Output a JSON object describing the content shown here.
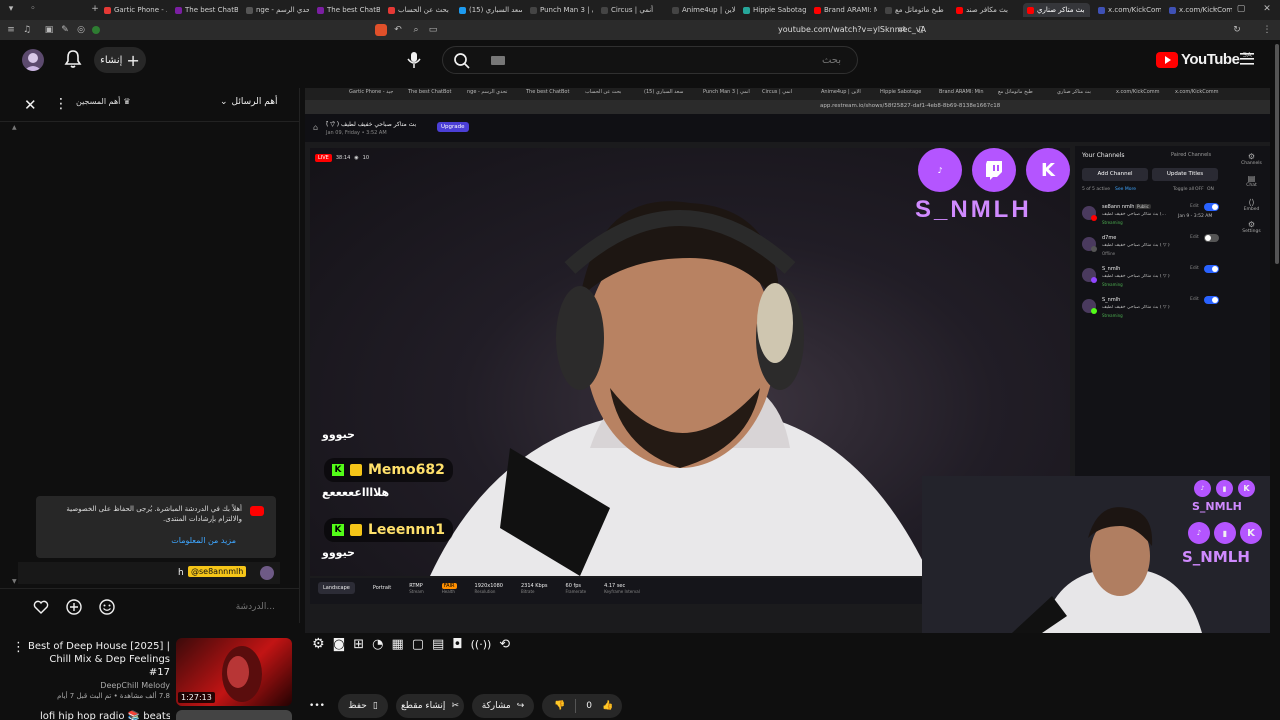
{
  "browser": {
    "tabs": [
      {
        "label": "Gartic Phone - جيد",
        "color": "#e53935"
      },
      {
        "label": "The best ChatBot",
        "color": "#7b1fa2"
      },
      {
        "label": "nge - تحدي الرسم",
        "color": "#555"
      },
      {
        "label": "The best ChatBot",
        "color": "#7b1fa2"
      },
      {
        "label": "بحث عن الحساب",
        "color": "#e53935"
      },
      {
        "label": "(15) سعد السباري",
        "color": "#1d9bf0"
      },
      {
        "label": "Punch Man 3 | أنمي",
        "color": "#444"
      },
      {
        "label": "Circus | أنمي",
        "color": "#444"
      },
      {
        "label": "Anime4up | الاين",
        "color": "#444"
      },
      {
        "label": "Hippie Sabotage",
        "color": "#26a69a"
      },
      {
        "label": "Brand ARAMI: Min",
        "color": "#ff0000"
      },
      {
        "label": "طبخ ماتوماتل مع",
        "color": "#444"
      },
      {
        "label": "بث مكافر صند",
        "color": "#ff0000"
      },
      {
        "label": "بث متاكر صناري",
        "color": "#ff0000"
      },
      {
        "label": "x.com/KickComm",
        "color": "#3f51b5"
      },
      {
        "label": "x.com/KickComm",
        "color": "#3f51b5"
      }
    ],
    "url": "youtube.com/watch?v=ylSknmec_vA"
  },
  "youtube": {
    "logo_text": "YouTube",
    "region": "SA",
    "search_placeholder": "بحث",
    "create_label": "إنشاء"
  },
  "chat": {
    "top_label": "أهم الرسائل",
    "subscribers_label": "أهم المسجين",
    "notice_text": "أهلاً بك في الدردشة المباشرة. يُرجى الحفاظ على الخصوصية والالتزام بإرشادات المنتدى.",
    "notice_link": "مزيد من المعلومات",
    "message_user": "@se8annmlh",
    "message_text": "h",
    "input_placeholder": "الدردشة..."
  },
  "restream": {
    "tabs": [
      "Gartic Phone - جيد",
      "The best ChatBot",
      "nge - تحدي الرسم",
      "The best ChatBot",
      "بحث عن الحساب",
      "(15) سعد السباري",
      "Punch Man 3 | أنمي",
      "Circus | أنمي",
      "Anime4up | الاين",
      "Hippie Sabotage",
      "Brand ARAMI: Min",
      "طبخ ماتوماتل مع",
      "بث متاكر صناري",
      "x.com/KickComm",
      "x.com/KickComm"
    ],
    "url": "app.restream.io/shows/58f25827-daf1-4eb8-8b69-8138e1667c18",
    "stream_title": "بث متاكر صباحي خفيف لطيف ( ̄▽ ̄)",
    "stream_date": "Jan 09, Friday • 3:52 AM",
    "upgrade": "Upgrade",
    "live_badge": "LIVE",
    "live_time": "38:14",
    "viewers": "10",
    "watermark": "S_NMLH",
    "channels_title": "Your Channels",
    "paired_label": "Paired Channels",
    "add_channel": "Add Channel",
    "update_titles": "Update Titles",
    "active_count": "5 of 5 active",
    "toggle_all": "Toggle all",
    "off": "OFF",
    "on": "ON",
    "see_more": "See More",
    "channels": [
      {
        "name": "se8ann nmlh",
        "badge": "Public",
        "title": "بث متاكر صباحي خفيف لطيف (...",
        "status": "Streaming",
        "on": true,
        "platform": "yt"
      },
      {
        "name": "d7me",
        "badge": "",
        "title": "بث متاكر صباحي خفيف لطيف ( ̄▽ ̄)",
        "status": "Offline",
        "on": false,
        "platform": "x"
      },
      {
        "name": "S_nmlh",
        "badge": "",
        "title": "بث متاكر صباحي خفيف لطيف ( ̄▽ ̄)",
        "status": "Streaming",
        "on": true,
        "platform": "tw"
      },
      {
        "name": "S_nmlh",
        "badge": "",
        "title": "بث متاكر صباحي خفيف لطيف ( ̄▽ ̄)",
        "status": "Streaming",
        "on": true,
        "platform": "kick"
      }
    ],
    "channel_date": "Jan 9 - 3:52 AM",
    "edit": "Edit",
    "side_icons": [
      "Channels",
      "Chat",
      "Embed",
      "Settings"
    ],
    "overlay_messages": [
      {
        "user": "",
        "text": "حيووو"
      },
      {
        "user": "Memo682",
        "text": "هلااااعععععع"
      },
      {
        "user": "Leeennn1",
        "text": "حيووو"
      }
    ],
    "stats": [
      {
        "label": "Landscape",
        "sub": ""
      },
      {
        "label": "Portrait",
        "sub": ""
      },
      {
        "label": "RTMP",
        "sub": "Stream"
      },
      {
        "label": "FAIR",
        "sub": "Health"
      },
      {
        "label": "1920x1080",
        "sub": "Resolution"
      },
      {
        "label": "2314 Kbps",
        "sub": "Bitrate"
      },
      {
        "label": "60 fps",
        "sub": "Framerate"
      },
      {
        "label": "4.17 sec",
        "sub": "Keyframe Interval"
      }
    ]
  },
  "recommendations": [
    {
      "title": "Best of Deep House [2025] | Chill Mix & Dep Feelings #17",
      "channel": "DeepChill Melody",
      "meta": "7.8 ألف مشاهدة • تم البث قبل 7 أيام",
      "duration": "1:27:13"
    },
    {
      "title": "lofi hip hop radio 📚 beats to",
      "channel": "",
      "meta": "",
      "duration": ""
    }
  ],
  "actions": {
    "likes": "0",
    "share": "مشاركة",
    "clip": "إنشاء مقطع",
    "save": "حفظ"
  },
  "colors": {
    "accent": "#3ea6ff",
    "live": "#ff0000",
    "kick": "#53fc18",
    "twitch": "#9146ff",
    "purple": "#a24bff"
  }
}
